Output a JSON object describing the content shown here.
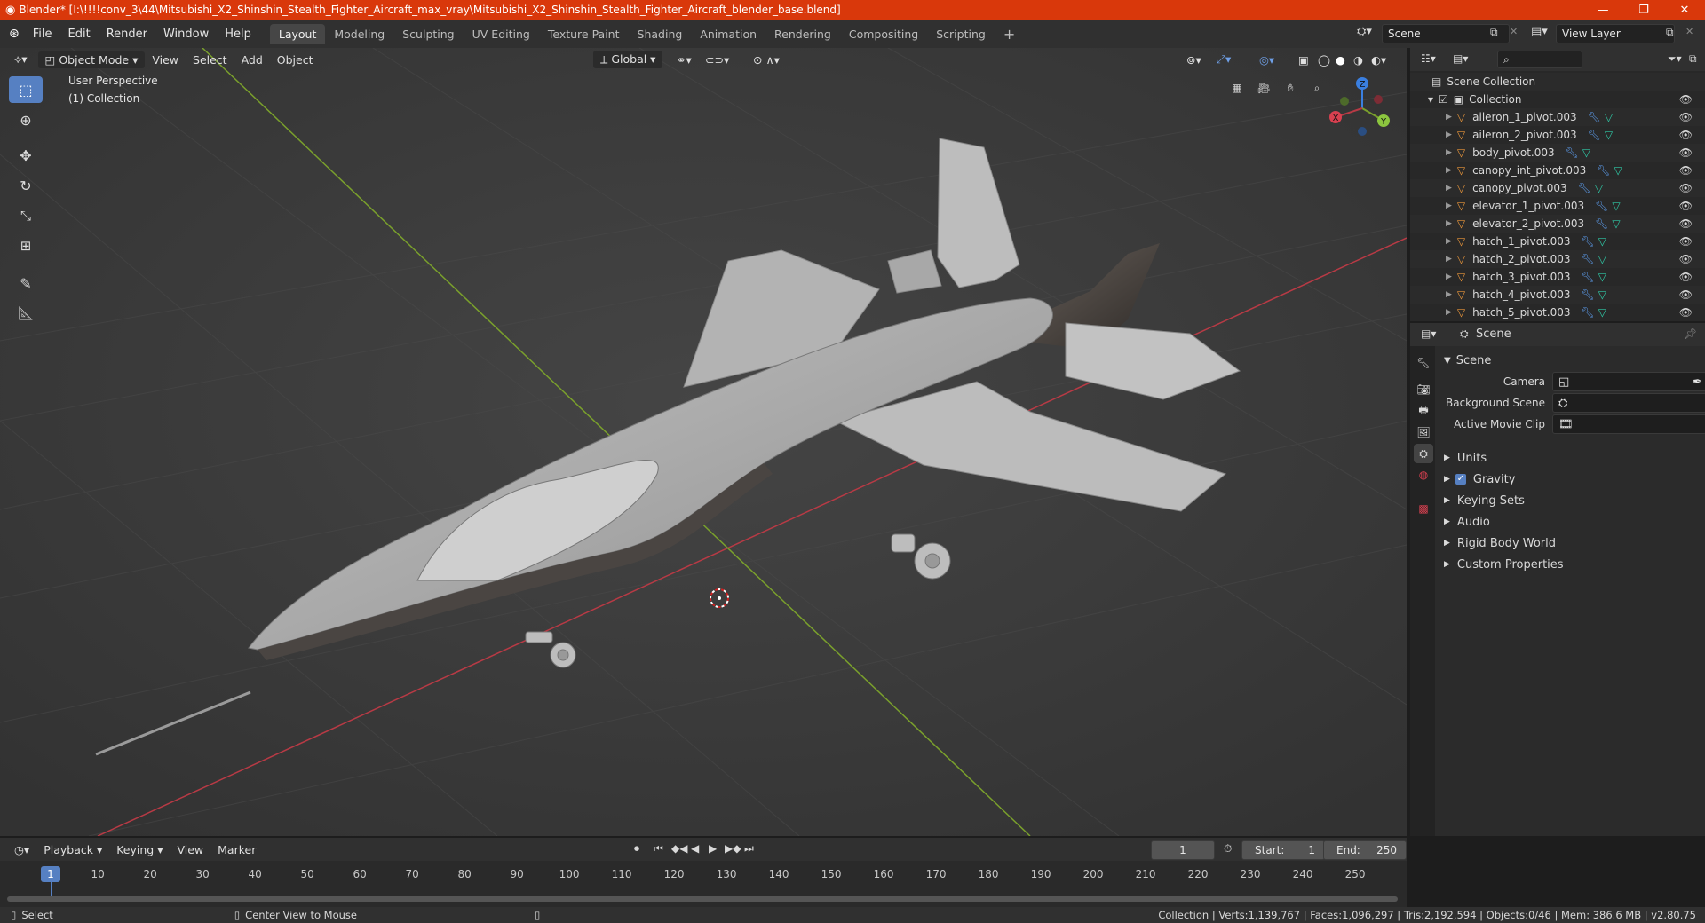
{
  "window": {
    "title": "Blender* [I:\\!!!!conv_3\\44\\Mitsubishi_X2_Shinshin_Stealth_Fighter_Aircraft_max_vray\\Mitsubishi_X2_Shinshin_Stealth_Fighter_Aircraft_blender_base.blend]",
    "minimize": "—",
    "maximize": "❐",
    "close": "✕"
  },
  "menu": [
    "File",
    "Edit",
    "Render",
    "Window",
    "Help"
  ],
  "workspaces": [
    "Layout",
    "Modeling",
    "Sculpting",
    "UV Editing",
    "Texture Paint",
    "Shading",
    "Animation",
    "Rendering",
    "Compositing",
    "Scripting"
  ],
  "add_workspace": "+",
  "scene_field": "Scene",
  "view_layer_field": "View Layer",
  "viewport": {
    "mode": "Object Mode",
    "menus": [
      "View",
      "Select",
      "Add",
      "Object"
    ],
    "orientation": "Global",
    "overlay_line1": "User Perspective",
    "overlay_line2": "(1) Collection",
    "gizmo": {
      "x": "X",
      "y": "Y",
      "z": "Z"
    }
  },
  "outliner": {
    "root": "Scene Collection",
    "collection": "Collection",
    "items": [
      "aileron_1_pivot.003",
      "aileron_2_pivot.003",
      "body_pivot.003",
      "canopy_int_pivot.003",
      "canopy_pivot.003",
      "elevator_1_pivot.003",
      "elevator_2_pivot.003",
      "hatch_1_pivot.003",
      "hatch_2_pivot.003",
      "hatch_3_pivot.003",
      "hatch_4_pivot.003",
      "hatch_5_pivot.003"
    ]
  },
  "properties": {
    "header": "Scene",
    "panel": "Scene",
    "camera_label": "Camera",
    "background_scene_label": "Background Scene",
    "active_movie_clip_label": "Active Movie Clip",
    "sections": [
      "Units",
      "Gravity",
      "Keying Sets",
      "Audio",
      "Rigid Body World",
      "Custom Properties"
    ],
    "gravity_checked": true
  },
  "timeline": {
    "menus": [
      "Playback",
      "Keying",
      "View",
      "Marker"
    ],
    "current_frame": "1",
    "start_label": "Start:",
    "start": "1",
    "end_label": "End:",
    "end": "250",
    "ticks": [
      "10",
      "20",
      "30",
      "40",
      "50",
      "60",
      "70",
      "80",
      "90",
      "100",
      "110",
      "120",
      "130",
      "140",
      "150",
      "160",
      "170",
      "180",
      "190",
      "200",
      "210",
      "220",
      "230",
      "240",
      "250"
    ],
    "playhead": "1"
  },
  "status": {
    "left_action": "Select",
    "middle_action": "Center View to Mouse",
    "stats": "Collection | Verts:1,139,767 | Faces:1,096,297 | Tris:2,192,594 | Objects:0/46 | Mem: 386.6 MB | v2.80.75"
  },
  "colors": {
    "title_bar": "#d9380b",
    "accent": "#5680c2",
    "x_axis": "#b83a45",
    "y_axis": "#7aa02c",
    "object_icon": "#e8953a",
    "modifier_icon": "#5c9bea",
    "mesh_icon": "#2fc9a6"
  }
}
